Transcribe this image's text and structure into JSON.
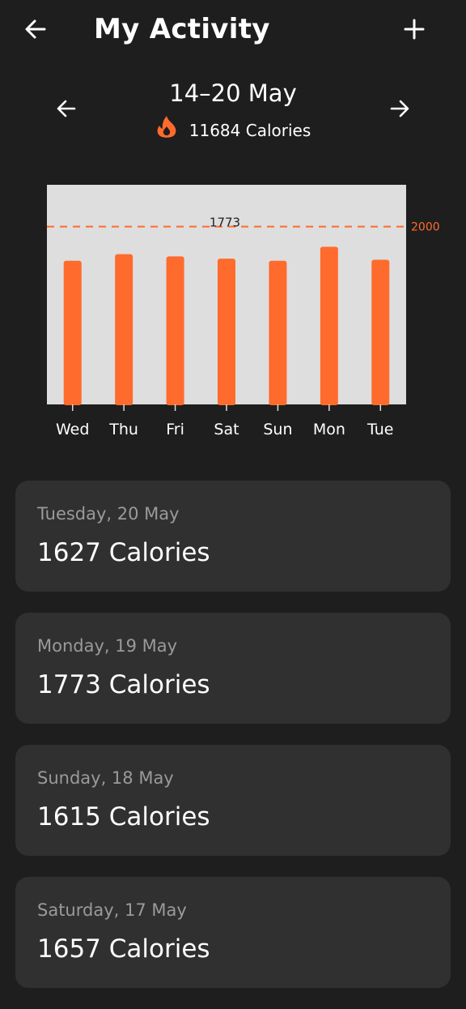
{
  "header": {
    "title": "My Activity"
  },
  "week": {
    "range": "14–20 May",
    "total": "11684 Calories"
  },
  "colors": {
    "background": "#1e1e1e",
    "accent": "#ff6b2c",
    "card": "#303030",
    "chart_bg": "#dedede"
  },
  "chart_data": {
    "type": "bar",
    "categories": [
      "Wed",
      "Thu",
      "Fri",
      "Sat",
      "Sun",
      "Mon",
      "Tue"
    ],
    "values": [
      1615,
      1690,
      1665,
      1640,
      1615,
      1773,
      1627
    ],
    "ylim": [
      0,
      2470
    ],
    "goal": 2000,
    "goal_label": "2000",
    "selected_label": "1773",
    "selected_index": 5,
    "grid": false
  },
  "days": [
    {
      "date": "Tuesday, 20 May",
      "calories": "1627 Calories"
    },
    {
      "date": "Monday, 19 May",
      "calories": "1773 Calories"
    },
    {
      "date": "Sunday, 18 May",
      "calories": "1615 Calories"
    },
    {
      "date": "Saturday, 17 May",
      "calories": "1657 Calories"
    }
  ]
}
